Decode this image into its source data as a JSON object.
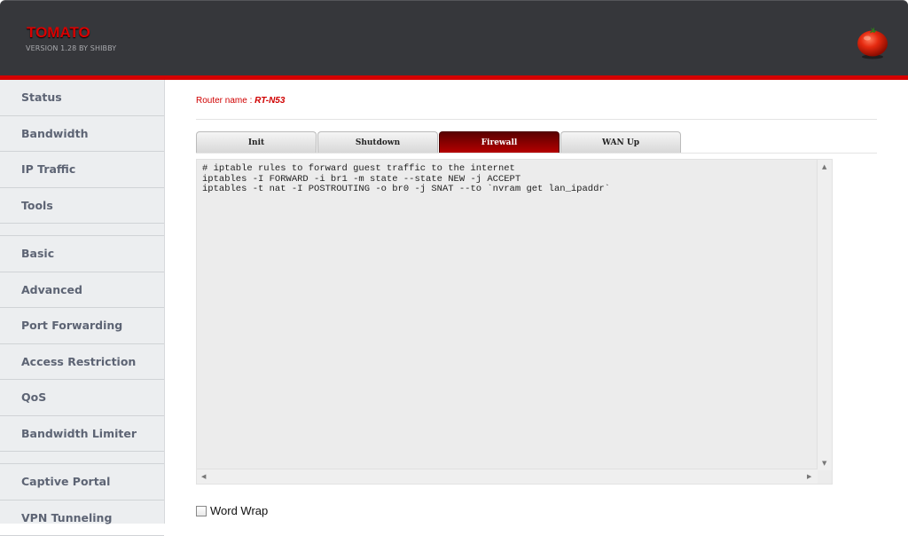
{
  "header": {
    "title": "TOMATO",
    "version": "VERSION 1.28 BY SHIBBY",
    "logo_icon": "tomato-icon",
    "accent_color": "#d50000"
  },
  "sidebar": {
    "groups": [
      [
        "Status",
        "Bandwidth",
        "IP Traffic",
        "Tools"
      ],
      [
        "Basic",
        "Advanced",
        "Port Forwarding",
        "Access Restriction",
        "QoS",
        "Bandwidth Limiter"
      ],
      [
        "Captive Portal",
        "VPN Tunneling"
      ]
    ]
  },
  "main": {
    "router_label": "Router name : ",
    "router_name": "RT-N53",
    "tabs": [
      {
        "label": "Init",
        "active": false
      },
      {
        "label": "Shutdown",
        "active": false
      },
      {
        "label": "Firewall",
        "active": true
      },
      {
        "label": "WAN Up",
        "active": false
      }
    ],
    "script_text": "# iptable rules to forward guest traffic to the internet\niptables -I FORWARD -i br1 -m state --state NEW -j ACCEPT\niptables -t nat -I POSTROUTING -o br0 -j SNAT --to `nvram get lan_ipaddr`",
    "word_wrap": {
      "label": "Word Wrap",
      "checked": false
    },
    "scroll_icons": {
      "up": "▲",
      "down": "▼",
      "left": "◀",
      "right": "▶"
    }
  }
}
